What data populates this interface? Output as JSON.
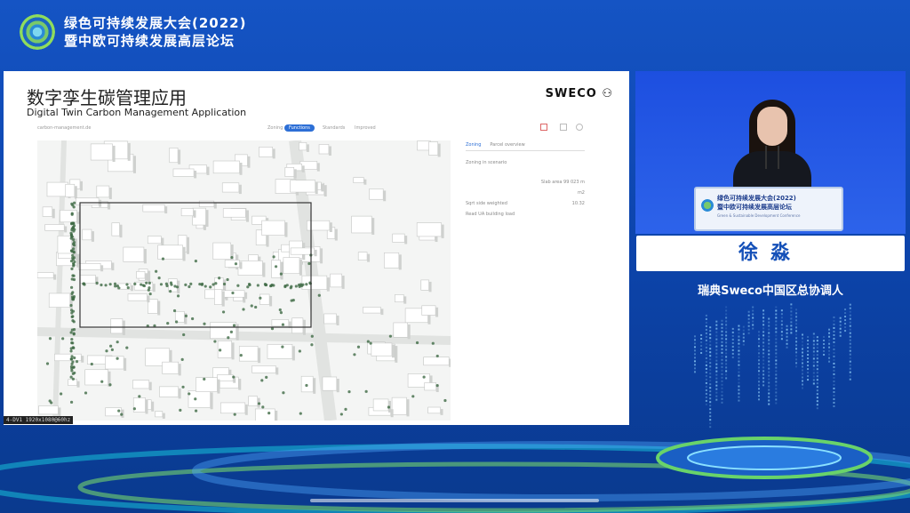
{
  "header": {
    "line1": "绿色可持续发展大会(2022)",
    "line2": "暨中欧可持续发展高层论坛"
  },
  "slide": {
    "title_cn": "数字孪生碳管理应用",
    "title_en": "Digital Twin Carbon Management Application",
    "brand": "SWECO",
    "app": {
      "url": "carbon-management.de",
      "tabs": [
        "Zoning",
        "Functions",
        "Standards",
        "Improved"
      ],
      "active_tab": "Functions"
    },
    "panel": {
      "tabs": [
        "Zoning",
        "Parcel overview"
      ],
      "rows": [
        "Zoning in scenario",
        "Slab area 99 023 m",
        "m2",
        "Sqrt side weighted",
        "10.32",
        "Read UA building load"
      ]
    },
    "video_badge": "4-DV1 1920x1080@60hz"
  },
  "speaker": {
    "podium_line1": "绿色可持续发展大会(2022)",
    "podium_line2": "暨中欧可持续发展高层论坛",
    "podium_line3": "Green & Sustainable Development Conference",
    "name": "徐淼",
    "title": "瑞典Sweco中国区总协调人"
  },
  "colors": {
    "background": "#0d45ad",
    "accent": "#2d6fd6",
    "name_text": "#1450b8"
  }
}
